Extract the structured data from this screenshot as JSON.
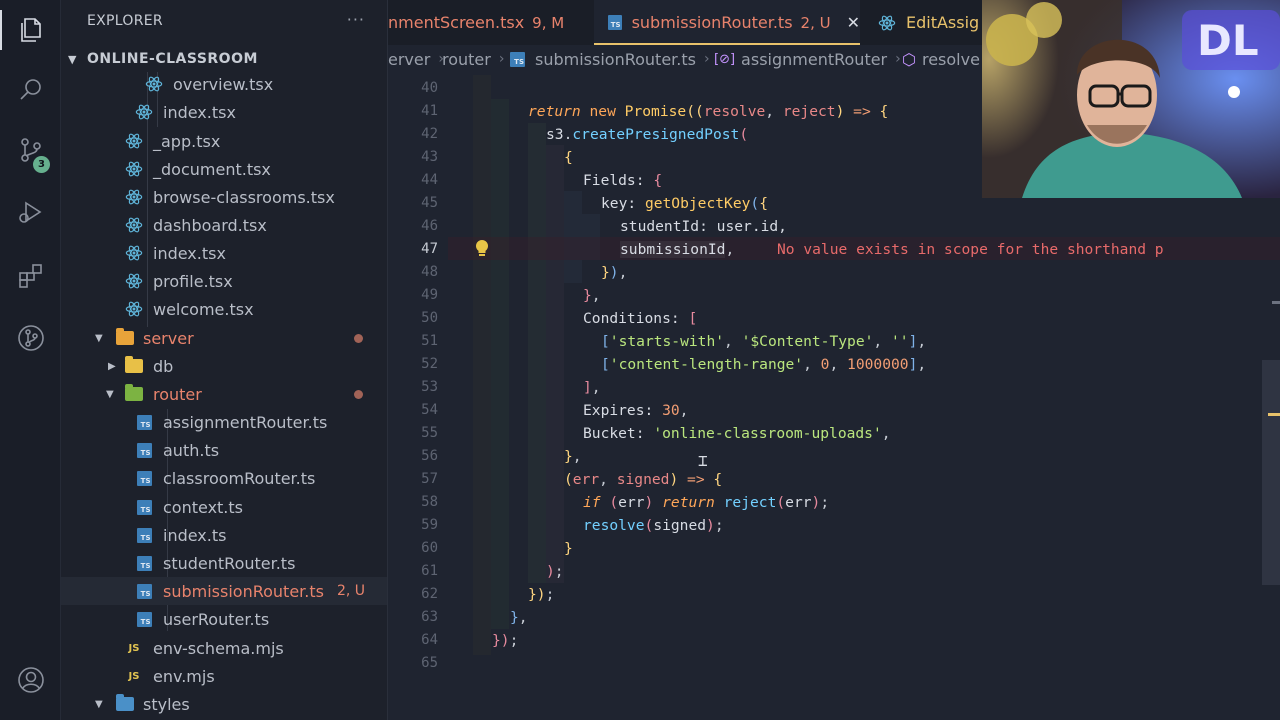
{
  "sidebar": {
    "title": "EXPLORER",
    "more": "···",
    "section": "ONLINE-CLASSROOM",
    "items": [
      {
        "label": "overview.tsx"
      },
      {
        "label": "index.tsx"
      },
      {
        "label": "_app.tsx"
      },
      {
        "label": "_document.tsx"
      },
      {
        "label": "browse-classrooms.tsx"
      },
      {
        "label": "dashboard.tsx"
      },
      {
        "label": "index.tsx"
      },
      {
        "label": "profile.tsx"
      },
      {
        "label": "welcome.tsx"
      },
      {
        "label": "server"
      },
      {
        "label": "db"
      },
      {
        "label": "router"
      },
      {
        "label": "assignmentRouter.ts"
      },
      {
        "label": "auth.ts"
      },
      {
        "label": "classroomRouter.ts"
      },
      {
        "label": "context.ts"
      },
      {
        "label": "index.ts"
      },
      {
        "label": "studentRouter.ts"
      },
      {
        "label": "submissionRouter.ts",
        "status": "2, U"
      },
      {
        "label": "userRouter.ts"
      },
      {
        "label": "env-schema.mjs"
      },
      {
        "label": "env.mjs"
      },
      {
        "label": "styles"
      }
    ]
  },
  "activity": {
    "scm_badge": "3"
  },
  "tabs": [
    {
      "label": "nmentScreen.tsx",
      "status": "9, M"
    },
    {
      "label": "submissionRouter.ts",
      "status": "2, U",
      "close": "✕"
    },
    {
      "label": "EditAssig"
    }
  ],
  "breadcrumb": [
    "erver",
    "router",
    "submissionRouter.ts",
    "assignmentRouter",
    "resolve"
  ],
  "editor": {
    "line_numbers": [
      "40",
      "41",
      "42",
      "43",
      "44",
      "45",
      "46",
      "47",
      "48",
      "49",
      "50",
      "51",
      "52",
      "53",
      "54",
      "55",
      "56",
      "57",
      "58",
      "59",
      "60",
      "61",
      "62",
      "63",
      "64",
      "65"
    ],
    "error_message": "No value exists in scope for the shorthand p",
    "tokens": {
      "return": "return",
      "new": "new",
      "Promise": "Promise",
      "resolve": "resolve",
      "reject": "reject",
      "arrow": "=>",
      "s3": "s3",
      "createPresignedPost": "createPresignedPost",
      "Fields": "Fields:",
      "key": "key:",
      "getObjectKey": "getObjectKey",
      "studentId": "studentId:",
      "userid": "user.id,",
      "submissionId": "submissionId",
      "Conditions": "Conditions:",
      "startsWith": "'starts-with'",
      "contentType": "'$Content-Type'",
      "emptyStr": "''",
      "contentLengthRange": "'content-length-range'",
      "zero": "0",
      "million": "1000000",
      "Expires": "Expires:",
      "thirty": "30",
      "Bucket": "Bucket:",
      "bucketName": "'online-classroom-uploads'",
      "err": "err",
      "signed": "signed",
      "if": "if"
    }
  }
}
